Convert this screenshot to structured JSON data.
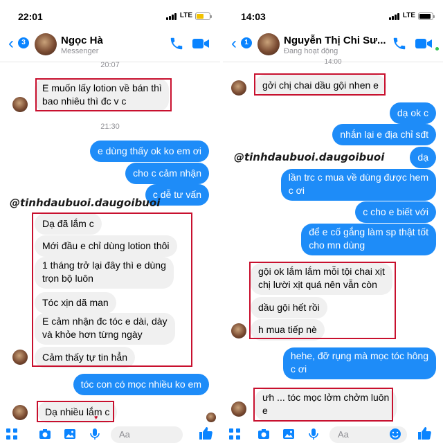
{
  "left": {
    "status": {
      "time": "22:01",
      "network": "LTE"
    },
    "header": {
      "back_count": "3",
      "name": "Ngọc Hà",
      "subtitle": "Messenger"
    },
    "messages": {
      "ts1": "20:07",
      "m1": "E muốn lấy lotion về bán thì",
      "m1b": "bao nhiêu thì đc v c",
      "ts2": "21:30",
      "o1": "e dùng thấy ok ko em ơi",
      "o2": "cho c cảm nhận",
      "o3": "c dễ tư vấn",
      "r1": "Dạ đã lắm c",
      "r2": "Mới đầu e chỉ dùng lotion thôi",
      "r3a": "1 tháng trở lại đây thì e dùng",
      "r3b": "trọn bộ luôn",
      "r4": "Tóc xịn dã man",
      "r5a": "E cảm nhận đc tóc e dài, dày",
      "r5b": "và khỏe hơn từng ngày",
      "r6": "Cảm thấy tự tin hẳn",
      "o4": "tóc con có mọc nhiều ko em",
      "r7": "Dạ nhiều lắm c"
    },
    "watermark": "@tinhdaubuoi.daugoibuoi",
    "composer_placeholder": "Aa"
  },
  "right": {
    "status": {
      "time": "14:03",
      "network": "LTE"
    },
    "header": {
      "back_count": "1",
      "name": "Nguyễn Thị Chi Sư...",
      "subtitle": "Đang hoạt động",
      "ts_partial": "14:00"
    },
    "messages": {
      "m1": "gởi chị chai dầu gội nhen e",
      "o1": "dạ ok c",
      "o2": "nhắn lại e địa chỉ sđt",
      "o3": "dạ",
      "o4a": "lần trc c mua về dùng được hem",
      "o4b": "c ơi",
      "o5": "c cho e biết với",
      "o6a": "để e cố gắng làm sp thật tốt",
      "o6b": "cho mn dùng",
      "r1a": "gội ok lắm lắm mỗi tội chai xịt",
      "r1b": "chị lười xịt quá nên vẫn còn",
      "r2": "dầu gội hết rồi",
      "r3": "h mua tiếp nè",
      "o7a": "hehe, đỡ rụng mà mọc tóc hông",
      "o7b": "c ơi",
      "r4a": "ưh ... tóc mọc lởm chởm luôn",
      "r4b": "e"
    },
    "watermark": "@tinhdaubuoi.daugoibuoi",
    "composer_placeholder": "Aa"
  },
  "colors": {
    "accent": "#1e8cf8",
    "highlight_box": "#c8102e",
    "battery_left": "#f2c200",
    "battery_right": "#000000"
  },
  "icons": [
    "chevron-left-icon",
    "phone-icon",
    "video-icon",
    "grid-icon",
    "camera-icon",
    "image-icon",
    "mic-icon",
    "like-icon",
    "signal-icon",
    "battery-icon"
  ]
}
